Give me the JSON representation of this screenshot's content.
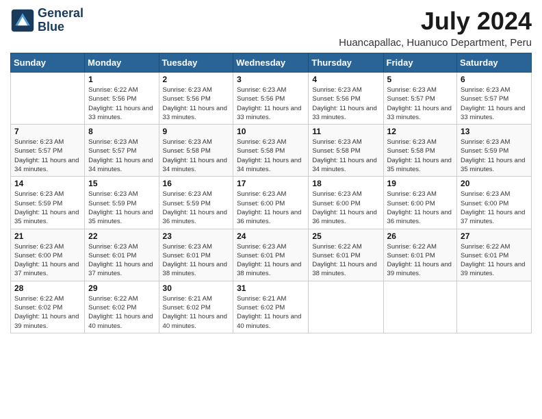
{
  "logo": {
    "text_line1": "General",
    "text_line2": "Blue"
  },
  "title": "July 2024",
  "subtitle": "Huancapallac, Huanuco Department, Peru",
  "header": {
    "days": [
      "Sunday",
      "Monday",
      "Tuesday",
      "Wednesday",
      "Thursday",
      "Friday",
      "Saturday"
    ]
  },
  "weeks": [
    [
      {
        "day": "",
        "sunrise": "",
        "sunset": "",
        "daylight": ""
      },
      {
        "day": "1",
        "sunrise": "Sunrise: 6:22 AM",
        "sunset": "Sunset: 5:56 PM",
        "daylight": "Daylight: 11 hours and 33 minutes."
      },
      {
        "day": "2",
        "sunrise": "Sunrise: 6:23 AM",
        "sunset": "Sunset: 5:56 PM",
        "daylight": "Daylight: 11 hours and 33 minutes."
      },
      {
        "day": "3",
        "sunrise": "Sunrise: 6:23 AM",
        "sunset": "Sunset: 5:56 PM",
        "daylight": "Daylight: 11 hours and 33 minutes."
      },
      {
        "day": "4",
        "sunrise": "Sunrise: 6:23 AM",
        "sunset": "Sunset: 5:56 PM",
        "daylight": "Daylight: 11 hours and 33 minutes."
      },
      {
        "day": "5",
        "sunrise": "Sunrise: 6:23 AM",
        "sunset": "Sunset: 5:57 PM",
        "daylight": "Daylight: 11 hours and 33 minutes."
      },
      {
        "day": "6",
        "sunrise": "Sunrise: 6:23 AM",
        "sunset": "Sunset: 5:57 PM",
        "daylight": "Daylight: 11 hours and 33 minutes."
      }
    ],
    [
      {
        "day": "7",
        "sunrise": "Sunrise: 6:23 AM",
        "sunset": "Sunset: 5:57 PM",
        "daylight": "Daylight: 11 hours and 34 minutes."
      },
      {
        "day": "8",
        "sunrise": "Sunrise: 6:23 AM",
        "sunset": "Sunset: 5:57 PM",
        "daylight": "Daylight: 11 hours and 34 minutes."
      },
      {
        "day": "9",
        "sunrise": "Sunrise: 6:23 AM",
        "sunset": "Sunset: 5:58 PM",
        "daylight": "Daylight: 11 hours and 34 minutes."
      },
      {
        "day": "10",
        "sunrise": "Sunrise: 6:23 AM",
        "sunset": "Sunset: 5:58 PM",
        "daylight": "Daylight: 11 hours and 34 minutes."
      },
      {
        "day": "11",
        "sunrise": "Sunrise: 6:23 AM",
        "sunset": "Sunset: 5:58 PM",
        "daylight": "Daylight: 11 hours and 34 minutes."
      },
      {
        "day": "12",
        "sunrise": "Sunrise: 6:23 AM",
        "sunset": "Sunset: 5:58 PM",
        "daylight": "Daylight: 11 hours and 35 minutes."
      },
      {
        "day": "13",
        "sunrise": "Sunrise: 6:23 AM",
        "sunset": "Sunset: 5:59 PM",
        "daylight": "Daylight: 11 hours and 35 minutes."
      }
    ],
    [
      {
        "day": "14",
        "sunrise": "Sunrise: 6:23 AM",
        "sunset": "Sunset: 5:59 PM",
        "daylight": "Daylight: 11 hours and 35 minutes."
      },
      {
        "day": "15",
        "sunrise": "Sunrise: 6:23 AM",
        "sunset": "Sunset: 5:59 PM",
        "daylight": "Daylight: 11 hours and 35 minutes."
      },
      {
        "day": "16",
        "sunrise": "Sunrise: 6:23 AM",
        "sunset": "Sunset: 5:59 PM",
        "daylight": "Daylight: 11 hours and 36 minutes."
      },
      {
        "day": "17",
        "sunrise": "Sunrise: 6:23 AM",
        "sunset": "Sunset: 6:00 PM",
        "daylight": "Daylight: 11 hours and 36 minutes."
      },
      {
        "day": "18",
        "sunrise": "Sunrise: 6:23 AM",
        "sunset": "Sunset: 6:00 PM",
        "daylight": "Daylight: 11 hours and 36 minutes."
      },
      {
        "day": "19",
        "sunrise": "Sunrise: 6:23 AM",
        "sunset": "Sunset: 6:00 PM",
        "daylight": "Daylight: 11 hours and 36 minutes."
      },
      {
        "day": "20",
        "sunrise": "Sunrise: 6:23 AM",
        "sunset": "Sunset: 6:00 PM",
        "daylight": "Daylight: 11 hours and 37 minutes."
      }
    ],
    [
      {
        "day": "21",
        "sunrise": "Sunrise: 6:23 AM",
        "sunset": "Sunset: 6:00 PM",
        "daylight": "Daylight: 11 hours and 37 minutes."
      },
      {
        "day": "22",
        "sunrise": "Sunrise: 6:23 AM",
        "sunset": "Sunset: 6:01 PM",
        "daylight": "Daylight: 11 hours and 37 minutes."
      },
      {
        "day": "23",
        "sunrise": "Sunrise: 6:23 AM",
        "sunset": "Sunset: 6:01 PM",
        "daylight": "Daylight: 11 hours and 38 minutes."
      },
      {
        "day": "24",
        "sunrise": "Sunrise: 6:23 AM",
        "sunset": "Sunset: 6:01 PM",
        "daylight": "Daylight: 11 hours and 38 minutes."
      },
      {
        "day": "25",
        "sunrise": "Sunrise: 6:22 AM",
        "sunset": "Sunset: 6:01 PM",
        "daylight": "Daylight: 11 hours and 38 minutes."
      },
      {
        "day": "26",
        "sunrise": "Sunrise: 6:22 AM",
        "sunset": "Sunset: 6:01 PM",
        "daylight": "Daylight: 11 hours and 39 minutes."
      },
      {
        "day": "27",
        "sunrise": "Sunrise: 6:22 AM",
        "sunset": "Sunset: 6:01 PM",
        "daylight": "Daylight: 11 hours and 39 minutes."
      }
    ],
    [
      {
        "day": "28",
        "sunrise": "Sunrise: 6:22 AM",
        "sunset": "Sunset: 6:02 PM",
        "daylight": "Daylight: 11 hours and 39 minutes."
      },
      {
        "day": "29",
        "sunrise": "Sunrise: 6:22 AM",
        "sunset": "Sunset: 6:02 PM",
        "daylight": "Daylight: 11 hours and 40 minutes."
      },
      {
        "day": "30",
        "sunrise": "Sunrise: 6:21 AM",
        "sunset": "Sunset: 6:02 PM",
        "daylight": "Daylight: 11 hours and 40 minutes."
      },
      {
        "day": "31",
        "sunrise": "Sunrise: 6:21 AM",
        "sunset": "Sunset: 6:02 PM",
        "daylight": "Daylight: 11 hours and 40 minutes."
      },
      {
        "day": "",
        "sunrise": "",
        "sunset": "",
        "daylight": ""
      },
      {
        "day": "",
        "sunrise": "",
        "sunset": "",
        "daylight": ""
      },
      {
        "day": "",
        "sunrise": "",
        "sunset": "",
        "daylight": ""
      }
    ]
  ]
}
